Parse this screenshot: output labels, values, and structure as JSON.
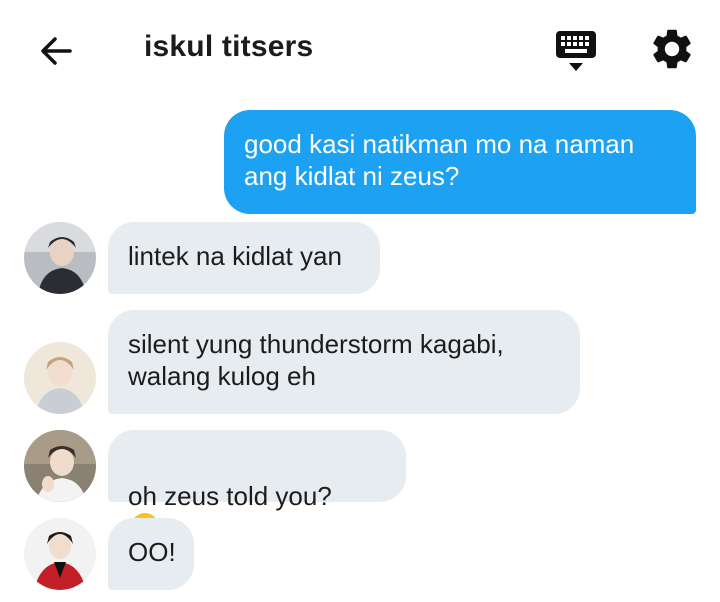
{
  "header": {
    "title": "iskul titsers",
    "back_icon": "arrow-left-icon",
    "keyboard_icon": "keyboard-icon",
    "settings_icon": "gear-icon"
  },
  "colors": {
    "outgoing_bubble": "#1da1f2",
    "incoming_bubble": "#e6ecf0",
    "text_dark": "#1c1c1c"
  },
  "messages": [
    {
      "direction": "outgoing",
      "text": "good kasi natikman mo na naman\nang kidlat ni zeus?"
    },
    {
      "direction": "incoming",
      "text": "lintek na kidlat yan"
    },
    {
      "direction": "incoming",
      "text": "silent yung thunderstorm kagabi,\nwalang kulog eh"
    },
    {
      "direction": "incoming",
      "text": "oh zeus told you?",
      "emoji": "flushed-face-emoji"
    },
    {
      "direction": "incoming",
      "text": "OO!"
    }
  ]
}
